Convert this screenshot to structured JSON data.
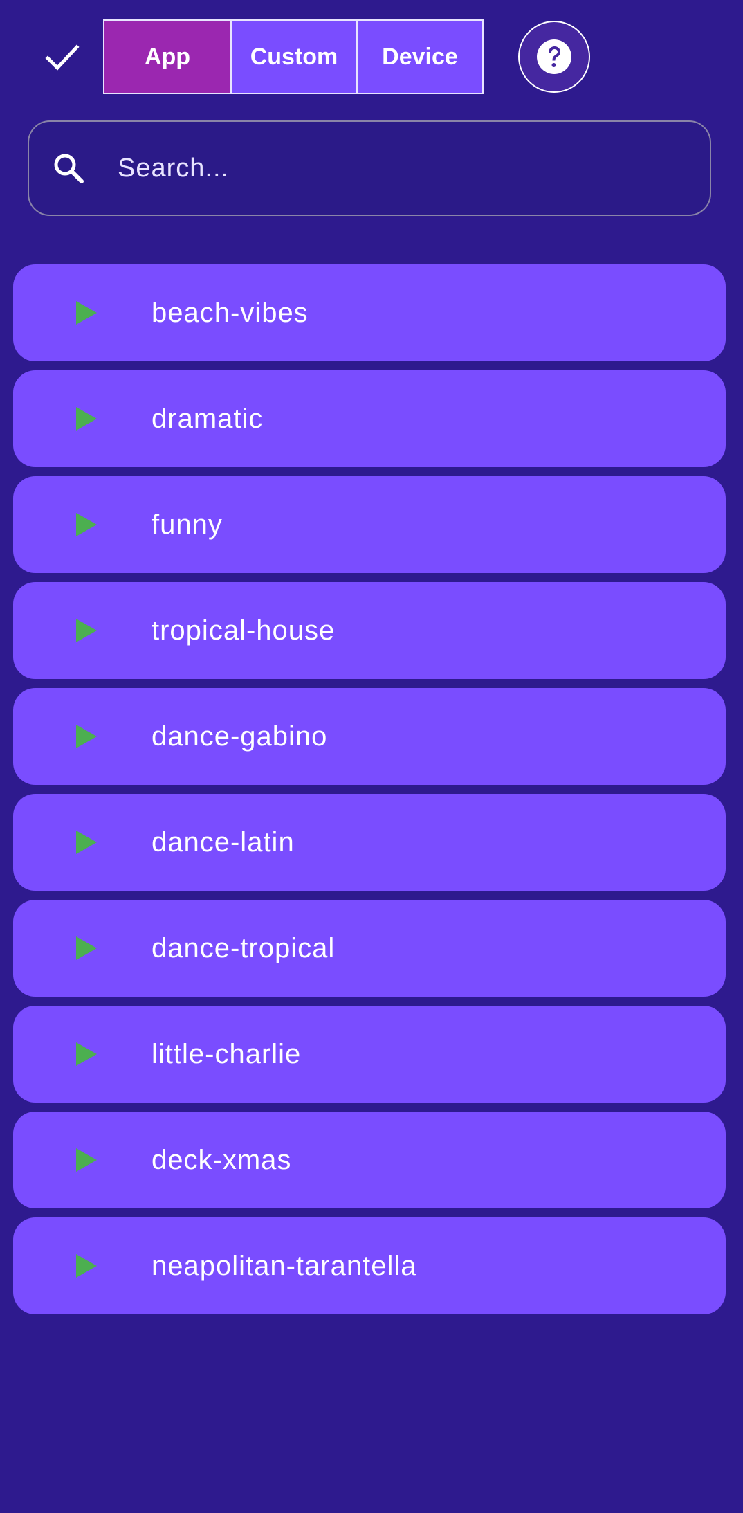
{
  "colors": {
    "background": "#2e1a8e",
    "item_bg": "#7a4dff",
    "segment_active": "#9b27b0",
    "play_icon": "#4caf50"
  },
  "toolbar": {
    "confirm_icon": "check-icon",
    "segments": [
      {
        "label": "App",
        "active": true
      },
      {
        "label": "Custom",
        "active": false
      },
      {
        "label": "Device",
        "active": false
      }
    ],
    "help_icon": "help-circle-icon"
  },
  "search": {
    "icon": "search-icon",
    "placeholder": "Search...",
    "value": ""
  },
  "sounds": [
    {
      "label": "beach-vibes"
    },
    {
      "label": "dramatic"
    },
    {
      "label": "funny"
    },
    {
      "label": "tropical-house"
    },
    {
      "label": "dance-gabino"
    },
    {
      "label": "dance-latin"
    },
    {
      "label": "dance-tropical"
    },
    {
      "label": "little-charlie"
    },
    {
      "label": "deck-xmas"
    },
    {
      "label": "neapolitan-tarantella"
    }
  ]
}
